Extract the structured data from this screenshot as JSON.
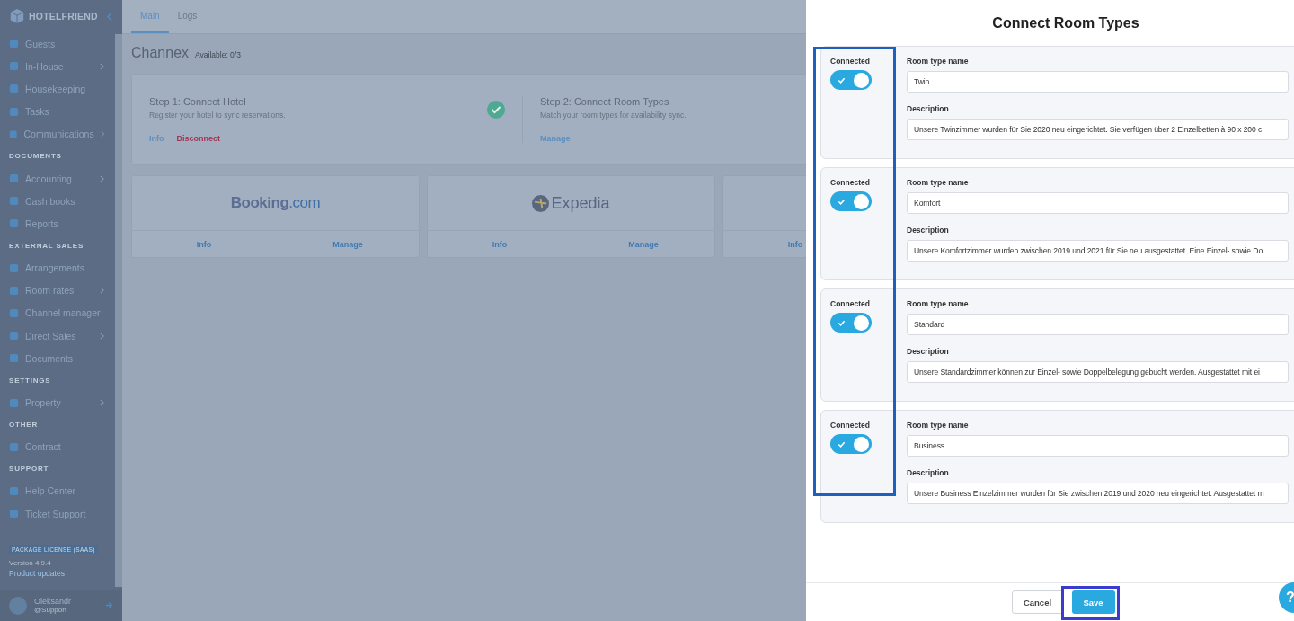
{
  "sidebar": {
    "logo": "HOTELFRIEND",
    "sections": [
      {
        "items": [
          {
            "label": "Guests",
            "expandable": false
          },
          {
            "label": "In-House",
            "expandable": true
          },
          {
            "label": "Housekeeping",
            "expandable": false
          },
          {
            "label": "Tasks",
            "expandable": false
          },
          {
            "label": "Communications",
            "expandable": true
          }
        ]
      },
      {
        "heading": "DOCUMENTS",
        "items": [
          {
            "label": "Accounting",
            "expandable": true
          },
          {
            "label": "Cash books",
            "expandable": false
          },
          {
            "label": "Reports",
            "expandable": false
          }
        ]
      },
      {
        "heading": "EXTERNAL SALES",
        "items": [
          {
            "label": "Arrangements",
            "expandable": false
          },
          {
            "label": "Room rates",
            "expandable": true
          },
          {
            "label": "Channel manager",
            "expandable": false
          },
          {
            "label": "Direct Sales",
            "expandable": true
          },
          {
            "label": "Documents",
            "expandable": false
          }
        ]
      },
      {
        "heading": "SETTINGS",
        "items": [
          {
            "label": "Property",
            "expandable": true
          }
        ]
      },
      {
        "heading": "OTHER",
        "items": [
          {
            "label": "Contract",
            "expandable": false
          }
        ]
      },
      {
        "heading": "SUPPORT",
        "items": [
          {
            "label": "Help Center",
            "expandable": false
          },
          {
            "label": "Ticket Support",
            "expandable": false
          }
        ]
      }
    ],
    "license": "PACKAGE LICENSE (SAAS)",
    "version": "Version 4.9.4",
    "updates_link": "Product updates",
    "user": {
      "name": "Oleksandr",
      "role": "@Support"
    }
  },
  "tabs": [
    {
      "label": "Main",
      "selected": true
    },
    {
      "label": "Logs",
      "selected": false
    }
  ],
  "page": {
    "title": "Channex",
    "subtitle": "Available: 0/3"
  },
  "steps": [
    {
      "title": "Step 1: Connect Hotel",
      "description": "Register your hotel to sync reservations.",
      "done": true,
      "links": [
        {
          "label": "Info",
          "kind": "normal"
        },
        {
          "label": "Disconnect",
          "kind": "danger"
        }
      ]
    },
    {
      "title": "Step 2: Connect Room Types",
      "description": "Match your room types for availability sync.",
      "done": false,
      "links": [
        {
          "label": "Manage",
          "kind": "normal"
        }
      ]
    }
  ],
  "channels": [
    {
      "kind": "booking",
      "logo": [
        "Booking",
        ".com"
      ],
      "links": [
        "Info",
        "Manage"
      ]
    },
    {
      "kind": "expedia",
      "logo": [
        "Expedia"
      ],
      "links": [
        "Info",
        "Manage"
      ]
    },
    {
      "kind": "hidden",
      "links": [
        "Info"
      ]
    }
  ],
  "dialog": {
    "title": "Connect Room Types",
    "rows": [
      {
        "connected_label": "Connected",
        "name_label": "Room type name",
        "description_label": "Description",
        "connected": true,
        "name": "Twin",
        "description": "Unsere Twinzimmer wurden für Sie 2020 neu eingerichtet.  Sie verfügen über 2 Einzelbetten à 90 x 200 c"
      },
      {
        "connected_label": "Connected",
        "name_label": "Room type name",
        "description_label": "Description",
        "connected": true,
        "name": "Komfort",
        "description": "Unsere Komfortzimmer wurden zwischen 2019 und 2021 für Sie neu ausgestattet. Eine Einzel- sowie Do"
      },
      {
        "connected_label": "Connected",
        "name_label": "Room type name",
        "description_label": "Description",
        "connected": true,
        "name": "Standard",
        "description": "Unsere Standardzimmer können zur Einzel- sowie Doppelbelegung gebucht werden.  Ausgestattet mit ei"
      },
      {
        "connected_label": "Connected",
        "name_label": "Room type name",
        "description_label": "Description",
        "connected": true,
        "name": "Business",
        "description": "Unsere Business Einzelzimmer wurden für Sie zwischen 2019 und 2020 neu eingerichtet. Ausgestattet m"
      }
    ],
    "cancel": "Cancel",
    "save": "Save",
    "help": "?"
  }
}
